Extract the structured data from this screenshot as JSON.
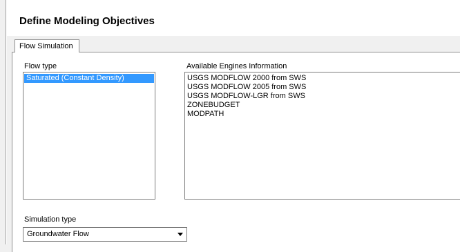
{
  "header": {
    "title": "Define Modeling Objectives"
  },
  "tabs": [
    {
      "label": "Flow Simulation"
    }
  ],
  "flow_type": {
    "label": "Flow type",
    "items": [
      "Saturated (Constant Density)"
    ],
    "selected_index": 0
  },
  "engines": {
    "label": "Available Engines Information",
    "items": [
      "USGS MODFLOW 2000 from SWS",
      "USGS MODFLOW 2005 from SWS",
      "USGS MODFLOW-LGR from SWS",
      "ZONEBUDGET",
      "MODPATH"
    ]
  },
  "simulation_type": {
    "label": "Simulation type",
    "value": "Groundwater Flow",
    "arrow_icon": "dropdown-arrow-icon"
  },
  "colors": {
    "selection": "#3399ff",
    "window_bg": "#f0f0f0",
    "panel_bg": "#ffffff"
  }
}
